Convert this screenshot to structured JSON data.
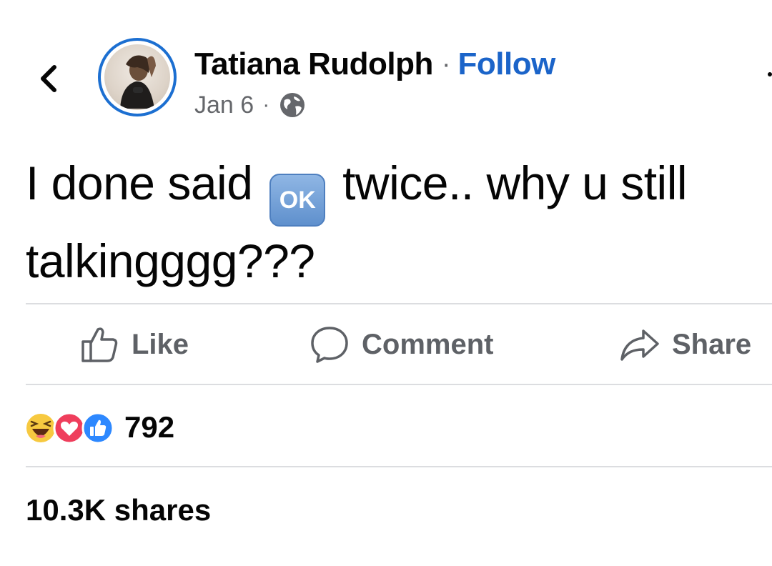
{
  "post": {
    "author": "Tatiana Rudolph",
    "separator": "·",
    "follow_label": "Follow",
    "date": "Jan 6",
    "date_separator": "·",
    "audience_icon": "globe-icon",
    "text_before_emoji": "I done said ",
    "emoji_label": "OK",
    "text_after_emoji": " twice.. why u still talkingggg???"
  },
  "actions": {
    "like_label": "Like",
    "comment_label": "Comment",
    "share_label": "Share"
  },
  "reactions": {
    "icons": [
      "haha-reaction-icon",
      "love-reaction-icon",
      "like-reaction-icon"
    ],
    "count": "792"
  },
  "shares": {
    "label": "10.3K shares"
  },
  "colors": {
    "accent": "#1b64c9",
    "avatar_ring": "#1c6fd1",
    "muted_text": "#65676b",
    "divider": "#dcdde0"
  }
}
